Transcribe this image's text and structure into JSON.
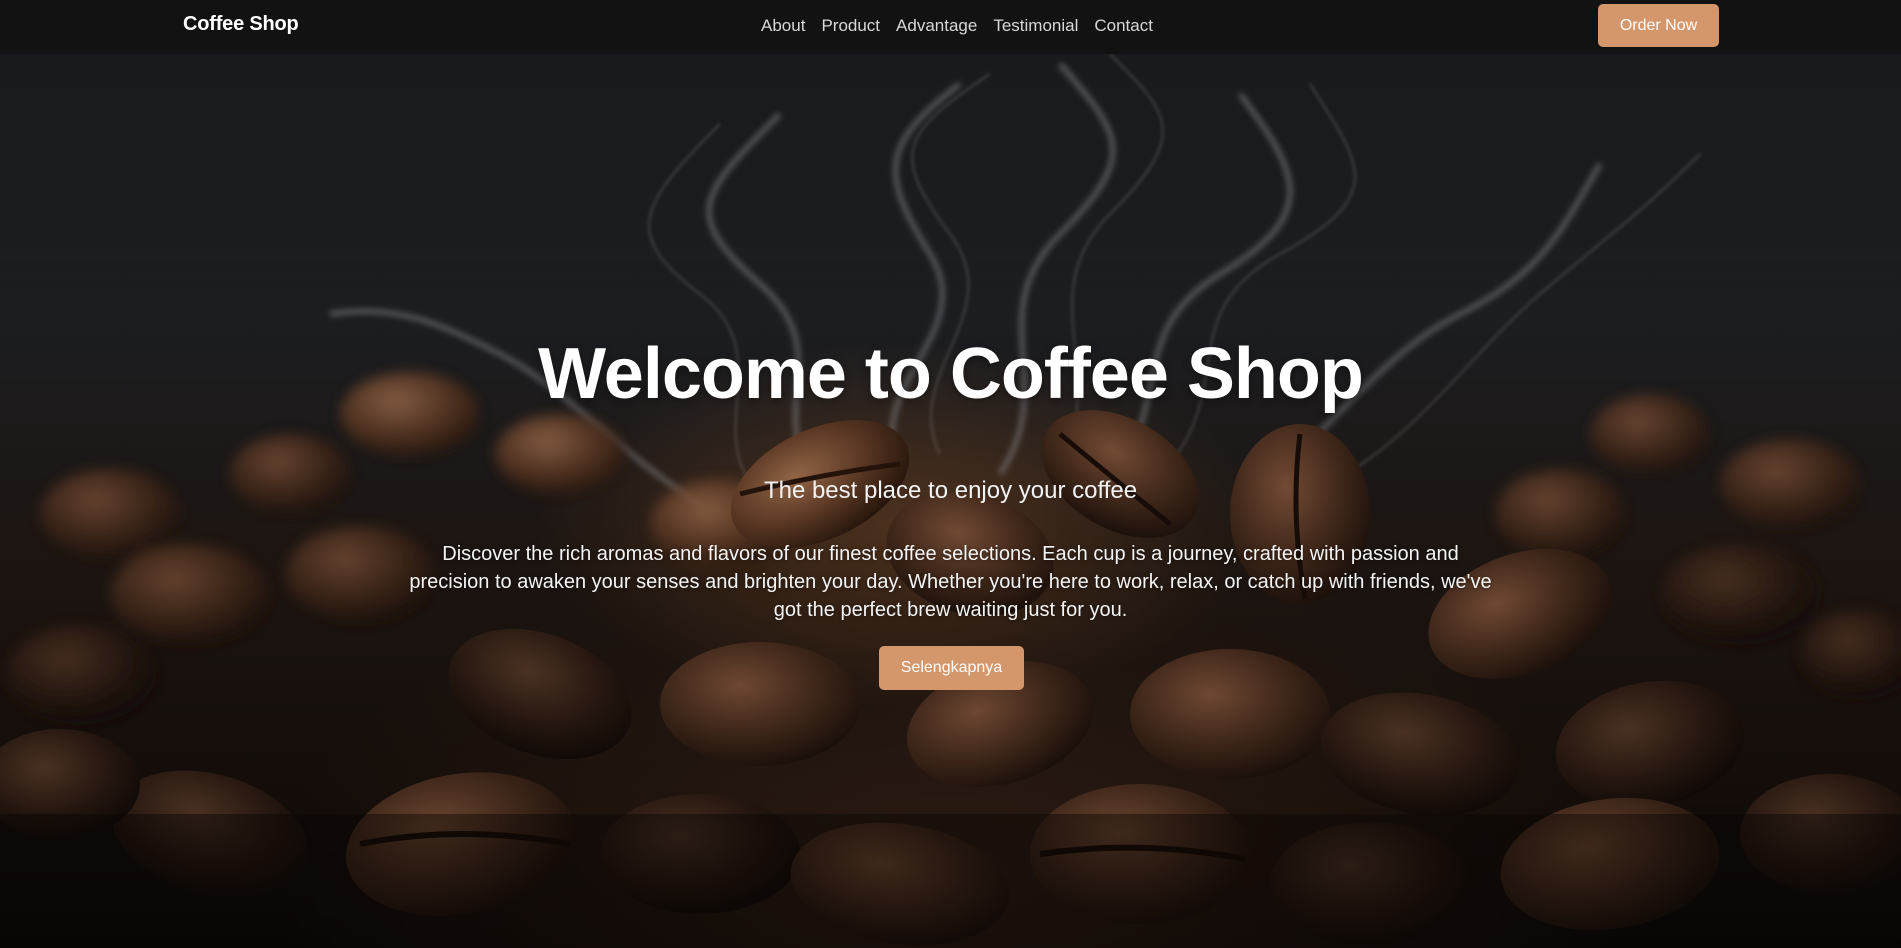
{
  "navbar": {
    "brand": "Coffee Shop",
    "links": [
      {
        "label": "About"
      },
      {
        "label": "Product"
      },
      {
        "label": "Advantage"
      },
      {
        "label": "Testimonial"
      },
      {
        "label": "Contact"
      }
    ],
    "order_button": "Order Now"
  },
  "hero": {
    "title": "Welcome to Coffee Shop",
    "subtitle": "The best place to enjoy your coffee",
    "description": "Discover the rich aromas and flavors of our finest coffee selections. Each cup is a journey, crafted with passion and precision to awaken your senses and brighten your day. Whether you're here to work, relax, or catch up with friends, we've got the perfect brew waiting just for you.",
    "cta_button": "Selengkapnya",
    "background_image": "roasted coffee beans with rising steam"
  },
  "colors": {
    "navbar_bg": "#121212",
    "accent": "#d4976b",
    "text": "#ffffff"
  }
}
